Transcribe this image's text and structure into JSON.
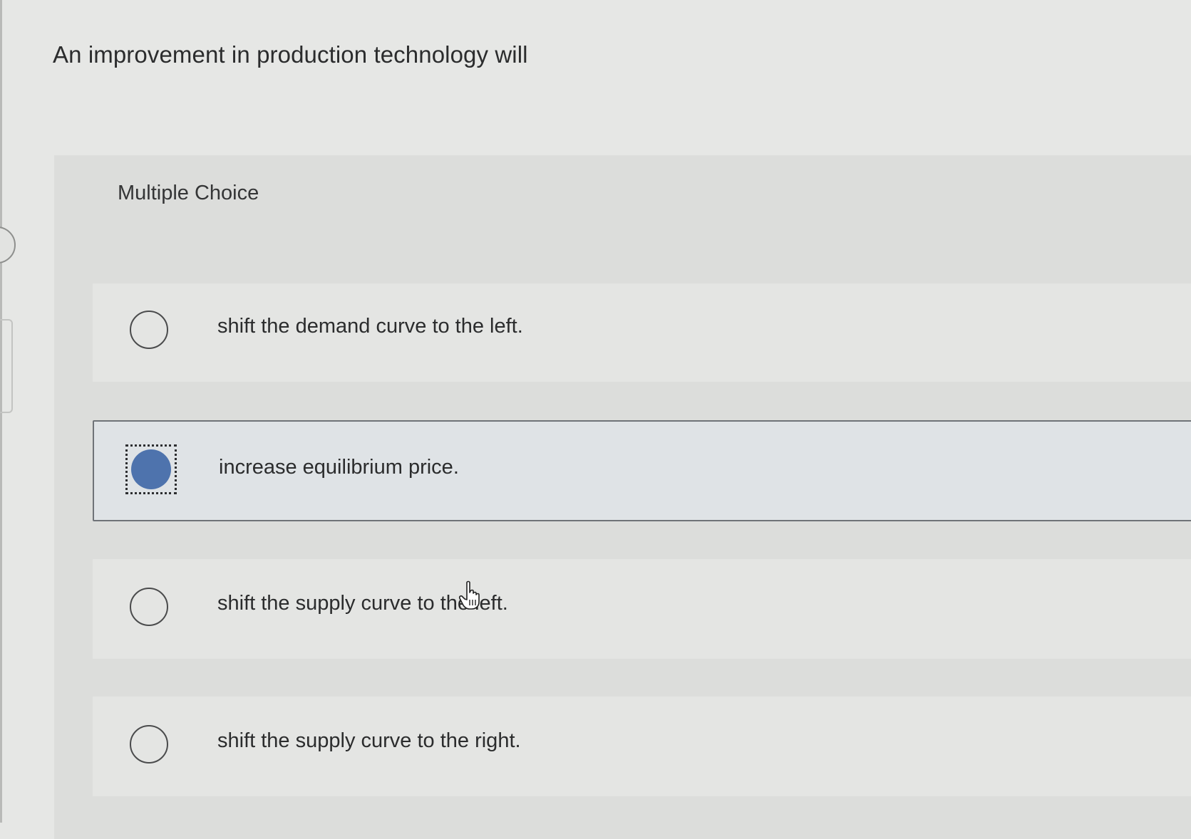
{
  "question": {
    "text": "An improvement in production technology will"
  },
  "multiple_choice": {
    "label": "Multiple Choice",
    "options": [
      {
        "text": "shift the demand curve to the left.",
        "selected": false
      },
      {
        "text": "increase equilibrium price.",
        "selected": true
      },
      {
        "text": "shift the supply curve to the left.",
        "selected": false
      },
      {
        "text": "shift the supply curve to the right.",
        "selected": false
      }
    ]
  },
  "colors": {
    "selected_radio": "#4e73ad",
    "page_background": "#e6e7e5",
    "panel_background": "#dcdddb"
  },
  "icons": {
    "cursor": "hand-pointer-icon"
  }
}
